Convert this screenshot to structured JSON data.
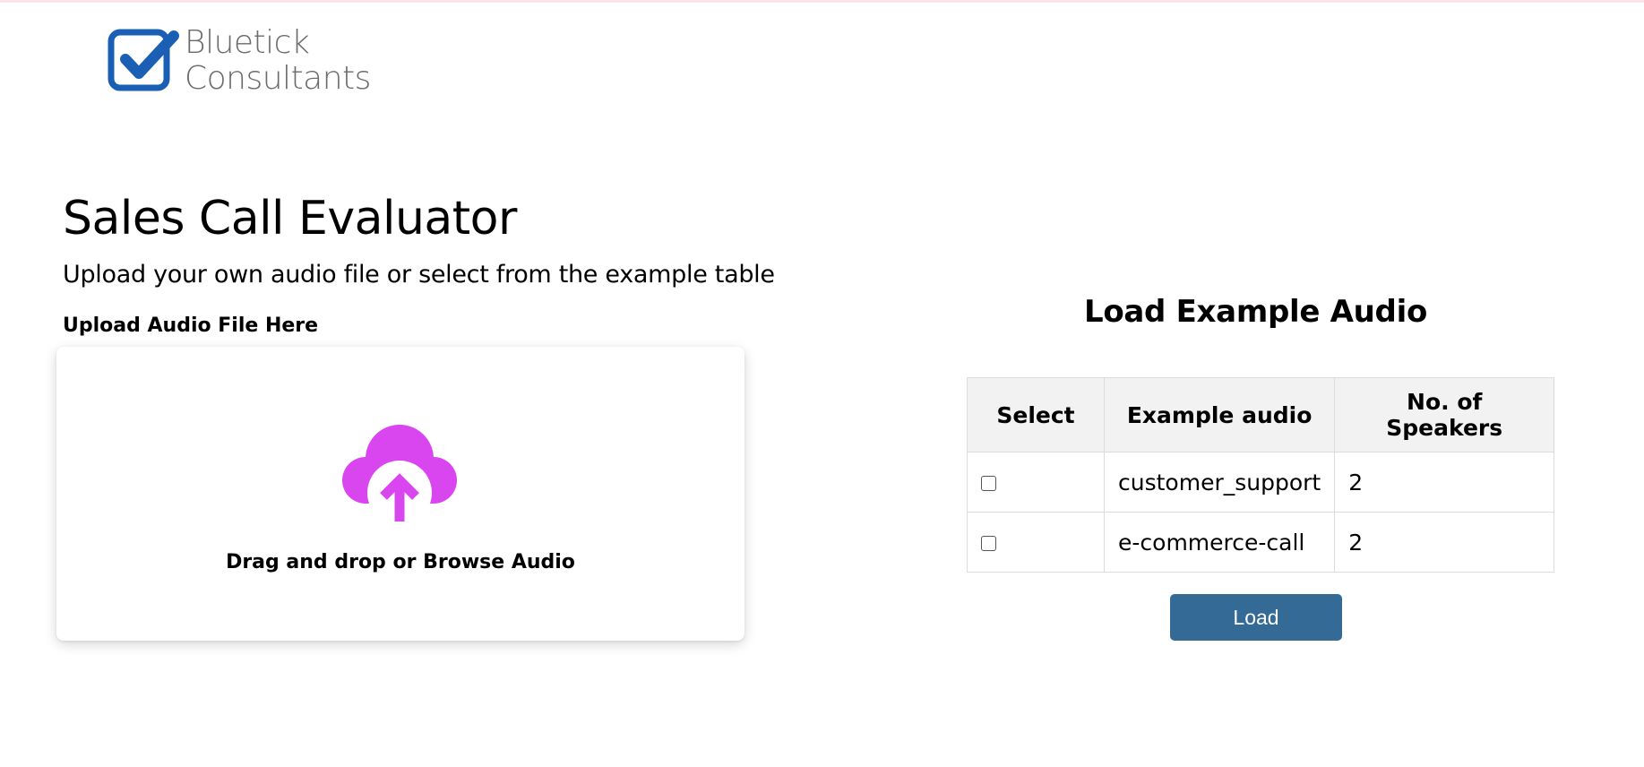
{
  "brand": {
    "line1": "Bluetick",
    "line2": "Consultants",
    "icon": "checkbox-check-icon",
    "color": "#1a5fb4"
  },
  "page": {
    "title": "Sales Call Evaluator",
    "subtitle": "Upload your own audio file or select from the example table"
  },
  "upload": {
    "label": "Upload Audio File Here",
    "dropzone_text": "Drag and drop or Browse Audio",
    "icon": "cloud-upload-icon",
    "icon_color": "#d946ef"
  },
  "examples": {
    "title": "Load Example Audio",
    "headers": [
      "Select",
      "Example audio",
      "No. of Speakers"
    ],
    "rows": [
      {
        "selected": false,
        "audio": "customer_support",
        "speakers": "2"
      },
      {
        "selected": false,
        "audio": "e-commerce-call",
        "speakers": "2"
      }
    ],
    "load_label": "Load",
    "button_color": "#346a96"
  }
}
